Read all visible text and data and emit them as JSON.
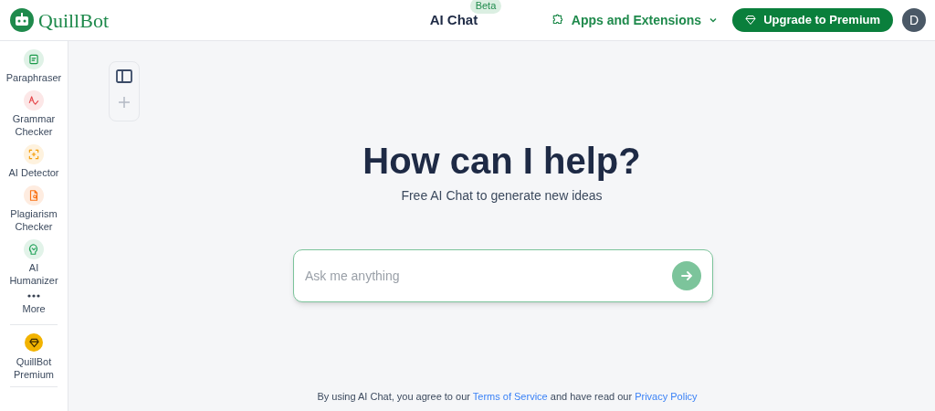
{
  "header": {
    "logo": "QuillBot",
    "title": "AI Chat",
    "badge": "Beta",
    "apps_menu": "Apps and Extensions",
    "upgrade_button": "Upgrade to Premium",
    "avatar": "D"
  },
  "sidebar": {
    "items": [
      {
        "kind": "paraphraser",
        "label": "Paraphraser"
      },
      {
        "kind": "grammar",
        "label": "Grammar Checker"
      },
      {
        "kind": "detector",
        "label": "AI Detector"
      },
      {
        "kind": "plagiarism",
        "label": "Plagiarism Checker"
      },
      {
        "kind": "humanizer",
        "label": "AI Humanizer"
      },
      {
        "kind": "more",
        "label": "More"
      }
    ],
    "premium": {
      "label": "QuillBot Premium"
    }
  },
  "main": {
    "heading": "How can I help?",
    "subheading": "Free AI Chat to generate new ideas",
    "input": {
      "placeholder": "Ask me anything"
    },
    "footer": {
      "before": "By using AI Chat, you agree to our",
      "link_1": "Terms of Service",
      "middle": "and have read our",
      "link_2": "Privacy Policy"
    }
  }
}
